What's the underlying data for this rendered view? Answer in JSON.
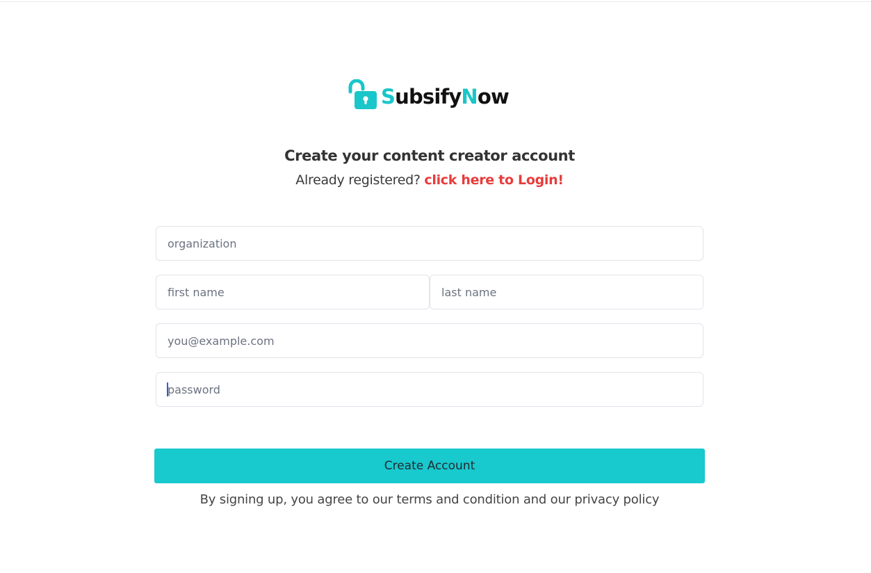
{
  "brand": {
    "name_first_letter": "S",
    "name_middle": "ubsify",
    "name_second_letter": "N",
    "name_end": "ow",
    "accent_color": "#19c6c9",
    "icon": "unlocked-padlock-icon"
  },
  "header": {
    "title": "Create your content creator account",
    "already_text": "Already registered?",
    "login_link": "click here to Login!"
  },
  "form": {
    "organization_placeholder": "organization",
    "first_name_placeholder": "first name",
    "last_name_placeholder": "last name",
    "email_placeholder": "you@example.com",
    "password_placeholder": "password",
    "submit_label": "Create Account"
  },
  "footer": {
    "terms_text": "By signing up, you agree to our terms and condition and our privacy policy"
  },
  "colors": {
    "button": "#18c9ce",
    "link": "#e83b3b"
  }
}
